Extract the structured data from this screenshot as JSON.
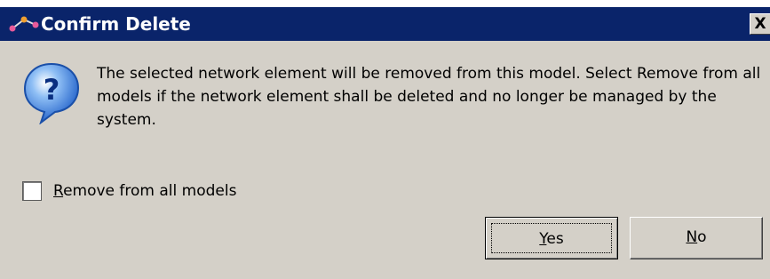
{
  "window": {
    "title": "Confirm Delete",
    "close_glyph": "X"
  },
  "icons": {
    "app": "network-element-icon",
    "message": "question-icon"
  },
  "message": {
    "text": "The selected network element will be removed from this model. Select Remove from all models if the network element shall be deleted and no longer be managed by the system."
  },
  "options": {
    "remove_all_label": "Remove from all models",
    "remove_all_checked": false
  },
  "buttons": {
    "yes_label": "Yes",
    "no_label": "No"
  },
  "colors": {
    "titlebar": "#0a246a",
    "dialog_background": "#d4d0c8",
    "question_icon": "#2a6fd6"
  }
}
